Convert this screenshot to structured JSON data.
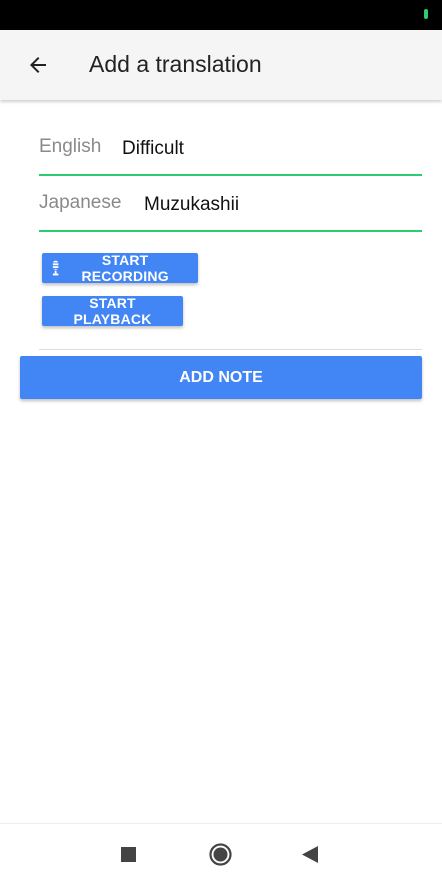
{
  "colors": {
    "accent": "#4285f4",
    "field_underline": "#2ecc71",
    "status_indicator": "#2ecc71"
  },
  "appbar": {
    "back_icon": "arrow-left-icon",
    "title": "Add a translation"
  },
  "form": {
    "english": {
      "label": "English",
      "value": "Difficult"
    },
    "japanese": {
      "label": "Japanese",
      "value": "Muzukashii"
    }
  },
  "buttons": {
    "start_recording": {
      "label": "START RECORDING",
      "icon": "microphone-icon"
    },
    "start_playback": {
      "label": "START PLAYBACK"
    },
    "add_note": {
      "label": "ADD NOTE"
    }
  },
  "navbar": {
    "recents_icon": "square-icon",
    "home_icon": "circle-icon",
    "back_icon": "triangle-back-icon"
  }
}
